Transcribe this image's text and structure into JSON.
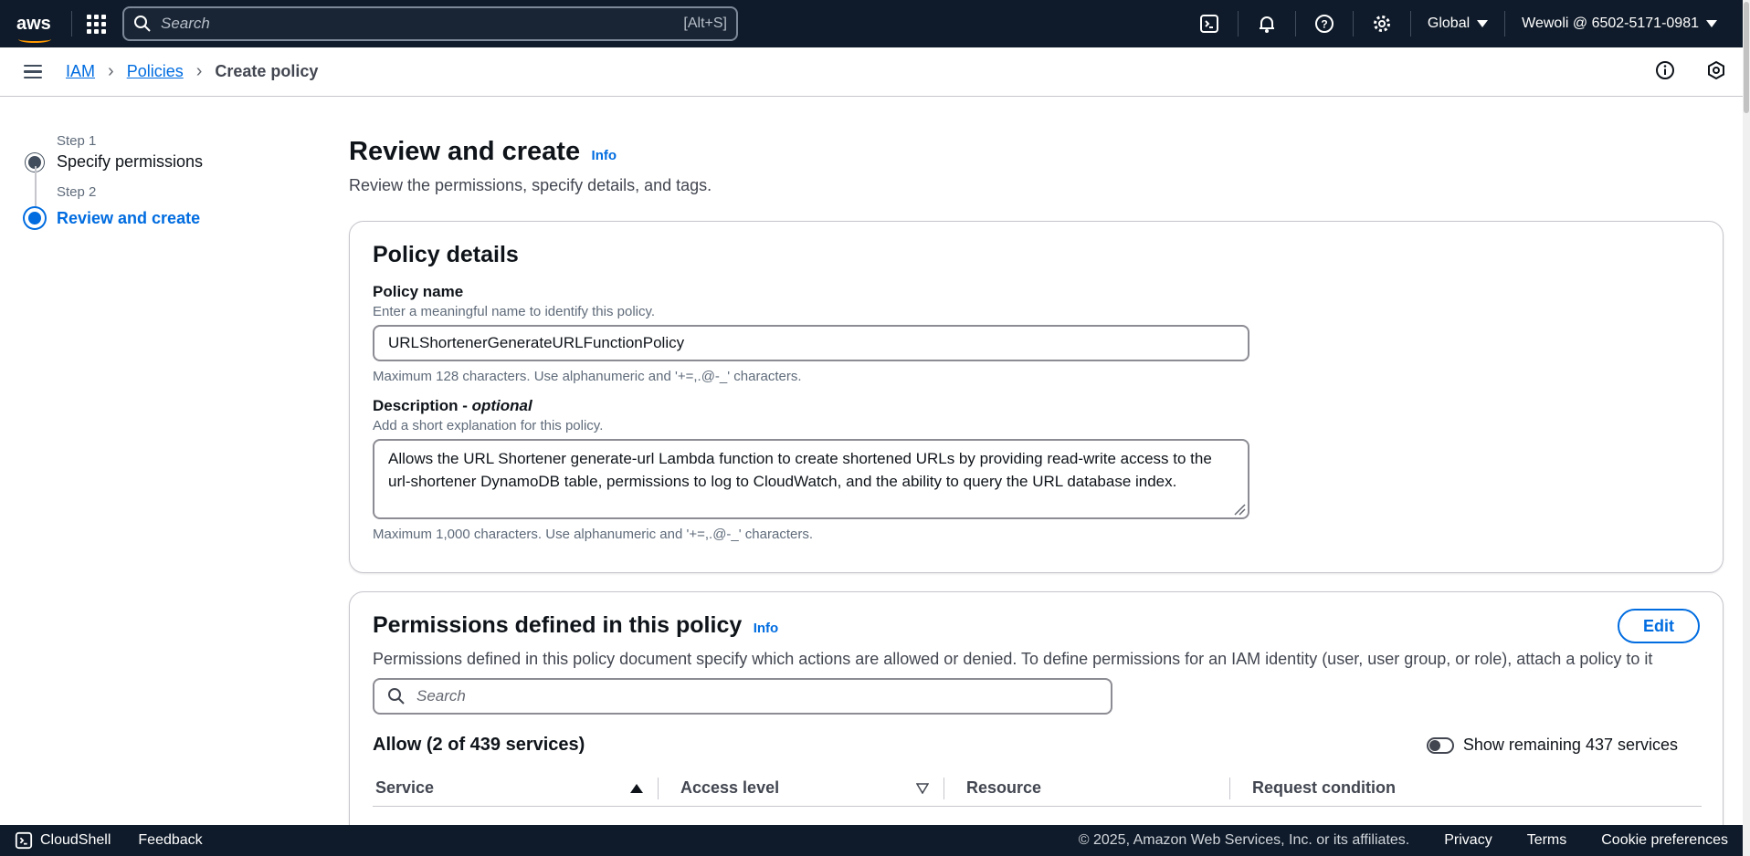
{
  "topnav": {
    "logo": "aws",
    "search_placeholder": "Search",
    "search_shortcut": "[Alt+S]",
    "region": "Global",
    "account": "Wewoli @ 6502-5171-0981",
    "icons": [
      "cloudshell-icon",
      "bell-icon",
      "help-icon",
      "settings-icon"
    ]
  },
  "breadcrumb": {
    "items": [
      "IAM",
      "Policies"
    ],
    "current": "Create policy"
  },
  "steps": [
    {
      "step": "Step 1",
      "name": "Specify permissions"
    },
    {
      "step": "Step 2",
      "name": "Review and create"
    }
  ],
  "header": {
    "title": "Review and create",
    "info": "Info",
    "subtitle": "Review the permissions, specify details, and tags."
  },
  "policy_details": {
    "title": "Policy details",
    "name_label": "Policy name",
    "name_desc": "Enter a meaningful name to identify this policy.",
    "name_value": "URLShortenerGenerateURLFunctionPolicy",
    "name_constraint": "Maximum 128 characters. Use alphanumeric and '+=,.@-_' characters.",
    "desc_label": "Description - ",
    "desc_label_optional": "optional",
    "desc_desc": "Add a short explanation for this policy.",
    "desc_value": "Allows the URL Shortener generate-url Lambda function to create shortened URLs by providing read-write access to the url-shortener DynamoDB table, permissions to log to CloudWatch, and the ability to query the URL database index.",
    "desc_constraint": "Maximum 1,000 characters. Use alphanumeric and '+=,.@-_' characters."
  },
  "permissions": {
    "title": "Permissions defined in this policy",
    "info": "Info",
    "edit": "Edit",
    "description": "Permissions defined in this policy document specify which actions are allowed or denied. To define permissions for an IAM identity (user, user group, or role), attach a policy to it",
    "search_placeholder": "Search",
    "allow_title": "Allow (2 of 439 services)",
    "toggle_label": "Show remaining 437 services",
    "columns": [
      "Service",
      "Access level",
      "Resource",
      "Request condition"
    ]
  },
  "footer": {
    "cloudshell": "CloudShell",
    "feedback": "Feedback",
    "copyright": "© 2025, Amazon Web Services, Inc. or its affiliates.",
    "links": [
      "Privacy",
      "Terms",
      "Cookie preferences"
    ]
  }
}
